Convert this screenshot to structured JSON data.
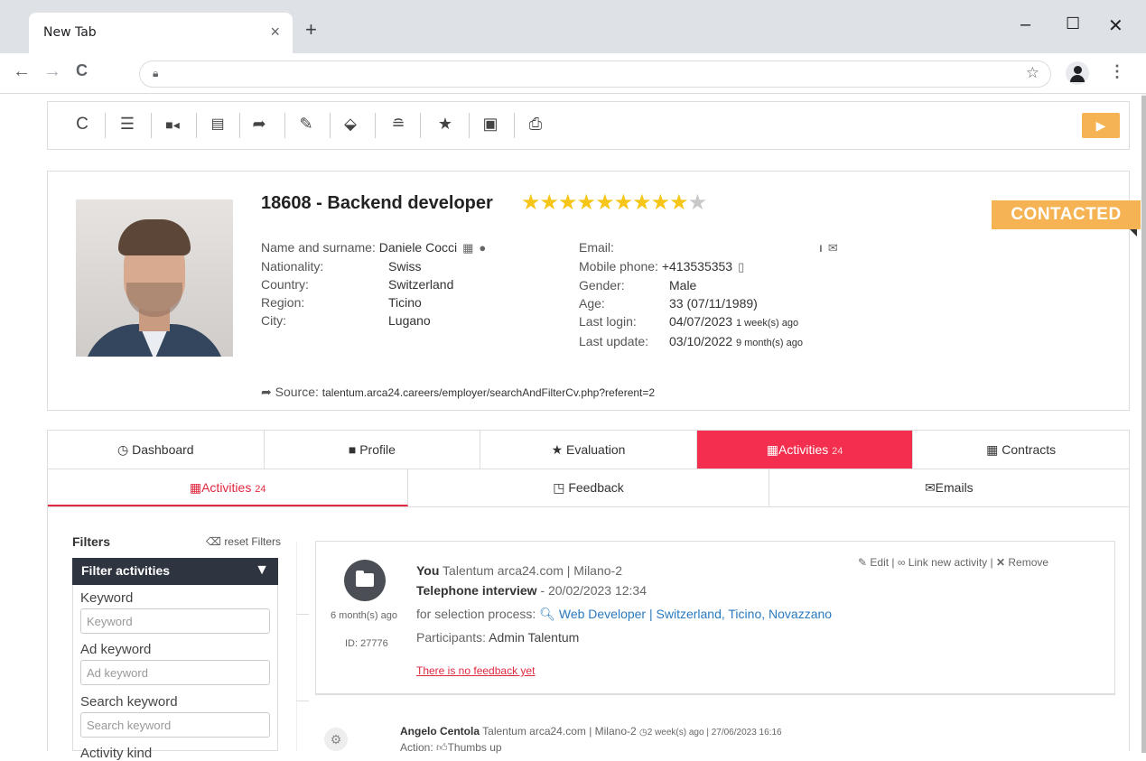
{
  "browser": {
    "tab_title": "New Tab",
    "tab_close": "×",
    "new_tab": "+",
    "minimize": "–",
    "maximize": "☐",
    "close": "✕",
    "back": "←",
    "forward": "→",
    "reload": "C",
    "address": "",
    "bookmark_star": "☆",
    "menu": "⋮"
  },
  "toolbar": {
    "icons": [
      "reload-icon",
      "list-icon",
      "video-icon",
      "document-icon",
      "forward-arrow-icon",
      "pencil-icon",
      "download-icon",
      "stack-icon",
      "star-icon",
      "briefcase-icon",
      "printer-icon"
    ],
    "play": "▶"
  },
  "profile": {
    "title": "18608 - Backend developer",
    "rating": 9,
    "rating_max": 10,
    "status": "CONTACTED",
    "left_fields": [
      {
        "label": "Name and surname:",
        "value": "Daniele Cocci"
      },
      {
        "label": "Nationality:",
        "value": "Swiss"
      },
      {
        "label": "Country:",
        "value": "Switzerland"
      },
      {
        "label": "Region:",
        "value": "Ticino"
      },
      {
        "label": "City:",
        "value": "Lugano"
      }
    ],
    "right_fields": {
      "email_label": "Email:",
      "email_value": "ı",
      "phone_label": "Mobile phone:",
      "phone_value": "+413535353",
      "gender_label": "Gender:",
      "gender_value": "Male",
      "age_label": "Age:",
      "age_value": "33 (07/11/1989)",
      "last_login_label": "Last login:",
      "last_login_value": "04/07/2023",
      "last_login_ago": "1 week(s) ago",
      "last_update_label": "Last update:",
      "last_update_value": "03/10/2022",
      "last_update_ago": "9 month(s) ago"
    },
    "source_label": "Source:",
    "source_url": "talentum.arca24.careers/employer/searchAndFilterCv.php?referent=2"
  },
  "main_tabs": [
    {
      "label": "Dashboard",
      "icon": "◷"
    },
    {
      "label": "Profile",
      "icon": "■"
    },
    {
      "label": "Evaluation",
      "icon": "★"
    },
    {
      "label": "Activities",
      "icon": "▦",
      "badge": "24"
    },
    {
      "label": "Contracts",
      "icon": "▦"
    }
  ],
  "sub_tabs": [
    {
      "label": "Activities",
      "icon": "▦",
      "badge": "24"
    },
    {
      "label": "Feedback",
      "icon": "◳"
    },
    {
      "label": "Emails",
      "icon": "✉"
    }
  ],
  "filters": {
    "title": "Filters",
    "reset": "reset Filters",
    "panel_title": "Filter activities",
    "keyword_label": "Keyword",
    "keyword_placeholder": "Keyword",
    "ad_keyword_label": "Ad keyword",
    "ad_keyword_placeholder": "Ad keyword",
    "search_keyword_label": "Search keyword",
    "search_keyword_placeholder": "Search keyword",
    "activity_kind_label": "Activity kind"
  },
  "activity": {
    "author": "You",
    "company": "Talentum arca24.com | Milano-2",
    "type": "Telephone interview",
    "datetime": "- 20/02/2023 12:34",
    "selection_label": "for selection process:",
    "selection_link": "Web Developer | Switzerland, Ticino, Novazzano",
    "participants_label": "Participants:",
    "participants": "Admin Talentum",
    "feedback": "There is no feedback yet",
    "ago": "6 month(s) ago",
    "id": "ID: 27776",
    "edit": "Edit",
    "link_new": "Link new activity",
    "remove": "Remove"
  },
  "activity2": {
    "author": "Angelo Centola",
    "company": "Talentum arca24.com | Milano-2",
    "ago": "2 week(s) ago | 27/06/2023 16:16",
    "action_label": "Action:",
    "action": "Thumbs up"
  }
}
